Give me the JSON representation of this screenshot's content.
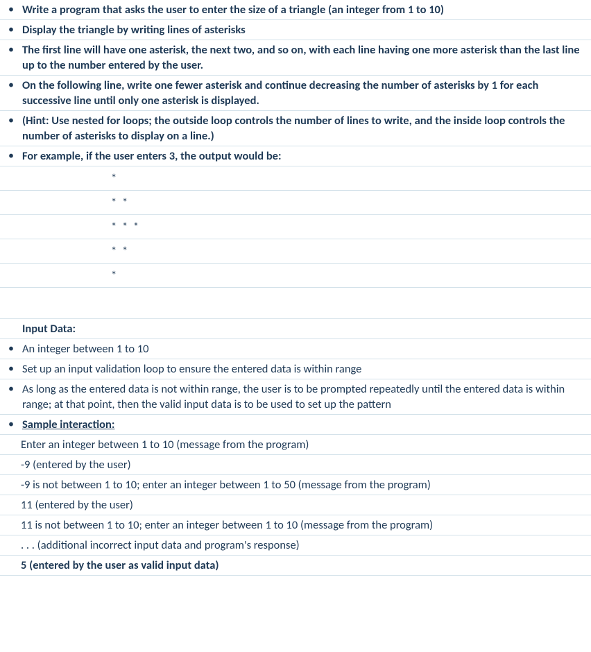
{
  "top": {
    "b1": "Write a program that asks the user to enter the size of a triangle (an integer from 1 to 10)",
    "b2": "Display the triangle by writing lines of asterisks",
    "b3": "The first line will have one asterisk, the next two, and so on, with each line having one more asterisk than the last line up to the number entered by the user.",
    "b4": "On the following line, write one fewer asterisk and continue decreasing the number of asterisks by 1 for each successive line until only one asterisk is displayed.",
    "b5": "(Hint: Use nested for loops; the outside loop controls the number of lines to write, and the inside loop controls the number of asterisks to display on a line.)",
    "b6": "For example, if the user enters 3, the output would be:"
  },
  "triangle": {
    "r1": "*",
    "r2": "* *",
    "r3": "* * *",
    "r4": "* *",
    "r5": "*"
  },
  "input": {
    "heading": "Input Data:",
    "b1": "An integer between 1 to 10",
    "b2": "Set up an input validation loop to ensure the entered data is within range",
    "b3": "As long as the entered data is not within range, the user is to be prompted repeatedly until the entered data is within range; at that point, then the valid input data is to be used to set up the pattern",
    "b4": "Sample interaction:"
  },
  "sample": {
    "l1": "Enter an integer between 1 to 10 (message from the program)",
    "l2": "-9  (entered by the user)",
    "l3": "-9  is not between 1 to 10;  enter an integer between 1 to 50 (message from the program)",
    "l4": "11 (entered by the user)",
    "l5": "11  is not between 1 to 10;  enter an integer between 1 to 10 (message from the program)",
    "l6": ". . . (additional incorrect input data and program's response)",
    "l7": "5 (entered by the user as valid input data)"
  },
  "bullet": "•"
}
